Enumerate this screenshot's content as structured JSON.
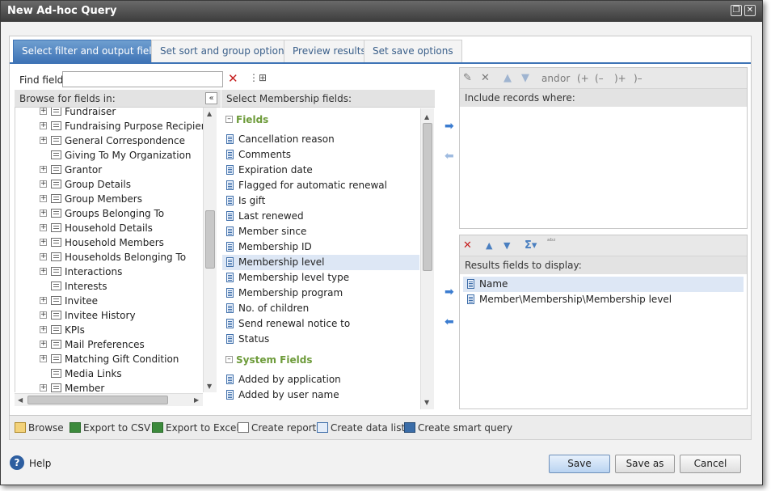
{
  "window": {
    "title": "New Ad-hoc Query"
  },
  "tabs": [
    {
      "label": "Select filter and output fields"
    },
    {
      "label": "Set sort and group options"
    },
    {
      "label": "Preview results"
    },
    {
      "label": "Set save options"
    }
  ],
  "find": {
    "label": "Find field:",
    "value": ""
  },
  "browse": {
    "header": "Browse for fields in:",
    "items": [
      {
        "label": "Fundraiser",
        "expandable": true
      },
      {
        "label": "Fundraising Purpose Recipient",
        "expandable": true
      },
      {
        "label": "General Correspondence",
        "expandable": true
      },
      {
        "label": "Giving To My Organization",
        "expandable": false
      },
      {
        "label": "Grantor",
        "expandable": true
      },
      {
        "label": "Group Details",
        "expandable": true
      },
      {
        "label": "Group Members",
        "expandable": true
      },
      {
        "label": "Groups Belonging To",
        "expandable": true
      },
      {
        "label": "Household Details",
        "expandable": true
      },
      {
        "label": "Household Members",
        "expandable": true
      },
      {
        "label": "Households Belonging To",
        "expandable": true
      },
      {
        "label": "Interactions",
        "expandable": true
      },
      {
        "label": "Interests",
        "expandable": false
      },
      {
        "label": "Invitee",
        "expandable": true
      },
      {
        "label": "Invitee History",
        "expandable": true
      },
      {
        "label": "KPIs",
        "expandable": true
      },
      {
        "label": "Mail Preferences",
        "expandable": true
      },
      {
        "label": "Matching Gift Condition",
        "expandable": true
      },
      {
        "label": "Media Links",
        "expandable": false
      },
      {
        "label": "Member",
        "expandable": true
      }
    ]
  },
  "select": {
    "header": "Select Membership fields:",
    "groups": [
      {
        "label": "Fields"
      },
      {
        "label": "System Fields"
      }
    ],
    "fields": [
      "Cancellation reason",
      "Comments",
      "Expiration date",
      "Flagged for automatic renewal",
      "Is gift",
      "Last renewed",
      "Member since",
      "Membership ID",
      "Membership level",
      "Membership level type",
      "Membership program",
      "No. of children",
      "Send renewal notice to",
      "Status"
    ],
    "system_fields": [
      "Added by application",
      "Added by user name"
    ],
    "selected": "Membership level"
  },
  "filter": {
    "toolbar": {
      "and": "and",
      "or": "or",
      "open_plus": "(+",
      "open_minus": "(–",
      "close_plus": ")+",
      "close_minus": ")–"
    },
    "header": "Include records where:"
  },
  "results": {
    "header": "Results fields to display:",
    "items": [
      "Name",
      "Member\\Membership\\Membership level"
    ]
  },
  "actions": {
    "browse": "Browse",
    "export_csv": "Export to CSV",
    "export_excel": "Export to Excel",
    "create_report": "Create report",
    "create_data_list": "Create data list",
    "create_smart_query": "Create smart query"
  },
  "footer": {
    "help": "Help",
    "save": "Save",
    "save_as": "Save as",
    "cancel": "Cancel"
  },
  "colors": {
    "accent": "#3f74b6",
    "group_green": "#6d9b3a",
    "delete_red": "#c62020",
    "selection": "#dde7f5"
  }
}
